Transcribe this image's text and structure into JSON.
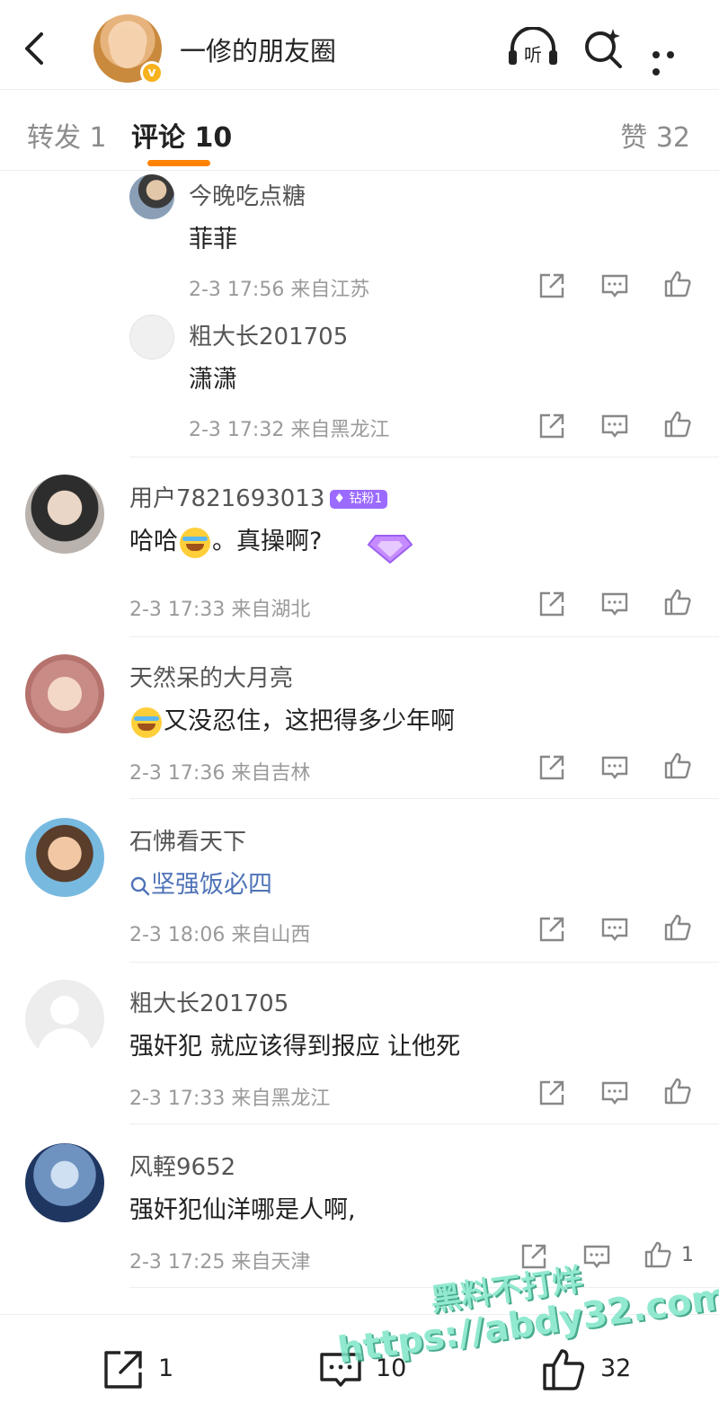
{
  "header": {
    "title": "一修的朋友圈"
  },
  "tabs": {
    "repost": "转发 1",
    "comment": "评论 10",
    "likes": "赞 32"
  },
  "replies": [
    {
      "user": "今晚吃点糖",
      "text": "菲菲",
      "meta": "2-3 17:56 来自江苏"
    },
    {
      "user": "粗大长201705",
      "text": "潇潇",
      "meta": "2-3 17:32 来自黑龙江"
    }
  ],
  "comments": [
    {
      "user": "用户7821693013",
      "badge": "钻粉1",
      "text_before": "哈哈",
      "text_after": "。真操啊?",
      "meta": "2-3 17:33 来自湖北"
    },
    {
      "user": "天然呆的大月亮",
      "text": "又没忍住，这把得多少年啊",
      "meta": "2-3 17:36 来自吉林"
    },
    {
      "user": "石怫看天下",
      "text": "坚强饭必四",
      "meta": "2-3 18:06 来自山西"
    },
    {
      "user": "粗大长201705",
      "text": "强奸犯 就应该得到报应 让他死",
      "meta": "2-3 17:33 来自黑龙江"
    },
    {
      "user": "风輊9652",
      "text": "强奸犯仙洋哪是人啊,",
      "meta": "2-3 17:25 来自天津",
      "like_count": "1"
    }
  ],
  "bottom": {
    "repost_count": "1",
    "comment_count": "10",
    "like_count": "32"
  },
  "watermark": {
    "line1": "黑料不打烊",
    "line2": "https://abdy32.com"
  },
  "colors": {
    "accent": "#ff8200",
    "topic_link": "#4e73b7",
    "fan_badge": "#9b6bff",
    "watermark": "#7ee6c8"
  }
}
